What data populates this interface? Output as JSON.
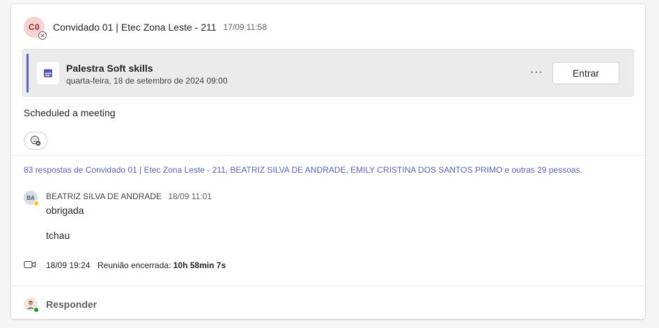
{
  "post": {
    "avatar_initials": "C0",
    "author": "Convidado 01 | Etec Zona Leste - 211",
    "timestamp": "17/09 11:58"
  },
  "meeting": {
    "title": "Palestra Soft skills",
    "date": "quarta-feira, 18 de setembro de 2024 09:00",
    "more_label": "···",
    "join_label": "Entrar",
    "accent_color": "#5b5fc7",
    "icon": "calendar-icon"
  },
  "body_text": "Scheduled a meeting",
  "reaction_icon": "add-reaction-icon",
  "replies_summary": "83 respostas de Convidado 01 | Etec Zona Leste - 211, BEATRIZ SILVA DE ANDRADE, EMILY CRISTINA DOS SANTOS PRIMO e outras 29 pessoas.",
  "reply": {
    "avatar_initials": "BA",
    "author": "BEATRIZ SILVA DE ANDRADE",
    "time": "18/09 11:01",
    "messages": [
      "obrigada",
      "tchau"
    ]
  },
  "meeting_ended": {
    "icon": "video-camera-icon",
    "time": "18/09 19:24",
    "label": "Reunião encerrada:",
    "duration": "10h 58min 7s"
  },
  "respond": {
    "label": "Responder"
  },
  "colors": {
    "link": "#5b5fc7",
    "away": "#f8c21c",
    "online": "#13a10e"
  }
}
